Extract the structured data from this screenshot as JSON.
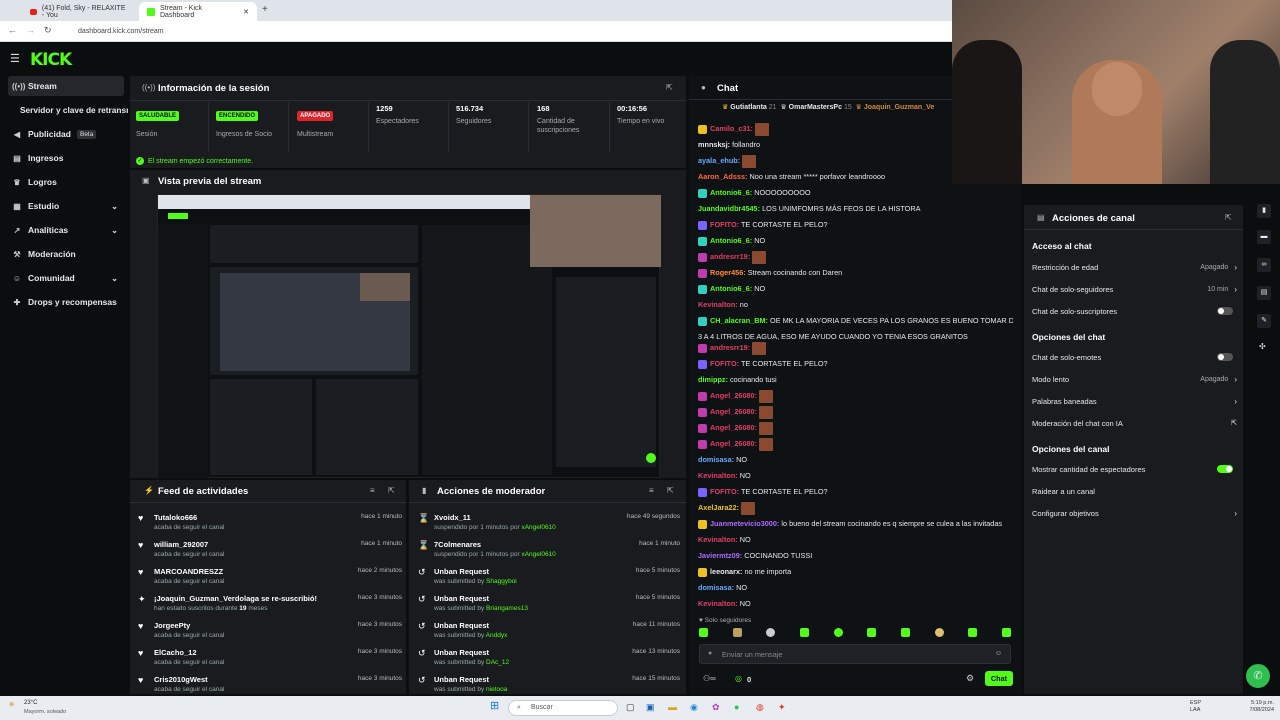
{
  "browser": {
    "tabs": [
      {
        "label": "(41) Fold, Sky - RELAXITE - You"
      },
      {
        "label": "Stream - Kick Dashboard"
      }
    ],
    "new_tab": "+",
    "url": "dashboard.kick.com/stream"
  },
  "app": {
    "logo": "KICK"
  },
  "sidebar": {
    "items": [
      {
        "label": "Stream",
        "icon": "broadcast-icon"
      },
      {
        "label": "Servidor y clave de retransm"
      },
      {
        "label": "Publicidad",
        "badge": "Beta"
      },
      {
        "label": "Ingresos"
      },
      {
        "label": "Logros"
      },
      {
        "label": "Estudio"
      },
      {
        "label": "Analíticas"
      },
      {
        "label": "Moderación"
      },
      {
        "label": "Comunidad"
      },
      {
        "label": "Drops y recompensas"
      }
    ]
  },
  "session": {
    "title": "Información de la sesión",
    "stats": [
      {
        "pill": "SALUDABLE",
        "label": "Sesión"
      },
      {
        "pill": "ENCENDIDO",
        "label": "Ingresos de Socio"
      },
      {
        "pill": "APAGADO",
        "label": "Multistream"
      },
      {
        "value": "1259",
        "label": "Espectadores"
      },
      {
        "value": "516.734",
        "label": "Seguidores"
      },
      {
        "value": "168",
        "label": "Cantidad de suscripciones"
      },
      {
        "value": "00:16:56",
        "label": "Tiempo en vivo"
      }
    ],
    "status": "El stream empezó correctamente."
  },
  "preview": {
    "title": "Vista previa del stream"
  },
  "feed": {
    "title": "Feed de actividades",
    "rows": [
      {
        "name": "Tutaloko666",
        "sub": "acaba de seguir el canal",
        "time": "hace 1 minuto"
      },
      {
        "name": "william_292007",
        "sub": "acaba de seguir el canal",
        "time": "hace 1 minuto"
      },
      {
        "name": "MARCOANDRESZZ",
        "sub": "acaba de seguir el canal",
        "time": "hace 2 minutos"
      },
      {
        "name": "¡Joaquin_Guzman_Verdolaga se re-suscribió!",
        "sub_pre": "han estado suscritos durante",
        "sub_num": "19",
        "sub_post": "meses",
        "time": "hace 3 minutos"
      },
      {
        "name": "JorgeePty",
        "sub": "acaba de seguir el canal",
        "time": "hace 3 minutos"
      },
      {
        "name": "ElCacho_12",
        "sub": "acaba de seguir el canal",
        "time": "hace 3 minutos"
      },
      {
        "name": "Cris2010gWest",
        "sub": "acaba de seguir el canal",
        "time": "hace 3 minutos"
      }
    ]
  },
  "mod": {
    "title": "Acciones de moderador",
    "rows": [
      {
        "name": "Xvoidx_11",
        "sub_pre": "suspendido por 1 minutos por",
        "by": "xAngel0610",
        "time": "hace 49 segundos"
      },
      {
        "name": "7Colmenares",
        "sub_pre": "suspendido por 1 minutos por",
        "by": "xAngel0610",
        "time": "hace 1 minuto"
      },
      {
        "name": "Unban Request",
        "sub_pre": "was submitted by",
        "by": "Shaggyboi",
        "time": "hace 5 minutos"
      },
      {
        "name": "Unban Request",
        "sub_pre": "was submitted by",
        "by": "Briangames13",
        "time": "hace 5 minutos"
      },
      {
        "name": "Unban Request",
        "sub_pre": "was submitted by",
        "by": "Anddyx",
        "time": "hace 11 minutos"
      },
      {
        "name": "Unban Request",
        "sub_pre": "was submitted by",
        "by": "DAc_12",
        "time": "hace 13 minutos"
      },
      {
        "name": "Unban Request",
        "sub_pre": "was submitted by",
        "by": "nietooa",
        "time": "hace 15 minutos"
      }
    ]
  },
  "chat": {
    "title": "Chat",
    "top_gifters": [
      {
        "name": "Gutiatlanta",
        "count": "21"
      },
      {
        "name": "OmarMastersPc",
        "count": "15"
      },
      {
        "name": "Joaquin_Guzman_Ve",
        "count": ""
      }
    ],
    "messages": [
      {
        "user": "Camilo_c31:",
        "text": "",
        "color": "#e23e66",
        "chip": "#f0c020",
        "emote": true
      },
      {
        "user": "mnnsksj:",
        "text": "follandro",
        "color": "#e6e8e9"
      },
      {
        "user": "ayala_ehub:",
        "text": "",
        "color": "#6aa8ff",
        "emote": true
      },
      {
        "user": "Aaron_Adsss:",
        "text": "Noo una stream ***** porfavor leandroooo",
        "color": "#ff6a3d"
      },
      {
        "user": "Antonio6_6:",
        "text": "NOOOOOOOOO",
        "color": "#53fc18",
        "chip": "#2fd0c0"
      },
      {
        "user": "Juandavidbr4545:",
        "text": "LOS UNIMFOMRS MÁS FEOS DE LA HISTORA",
        "color": "#53fc18"
      },
      {
        "user": "FOFITO:",
        "text": "TE CORTASTE EL PELO?",
        "color": "#e23e66",
        "chip": "#7b63ff"
      },
      {
        "user": "Antonio6_6:",
        "text": "NO",
        "color": "#53fc18",
        "chip": "#2fd0c0"
      },
      {
        "user": "andresrr19:",
        "text": "",
        "color": "#e23e66",
        "chip": "#c03ab0",
        "emote": true
      },
      {
        "user": "Roger456:",
        "text": "Stream cocinando con Daren",
        "color": "#ff8a3d",
        "chip": "#c03ab0"
      },
      {
        "user": "Antonio6_6:",
        "text": "NO",
        "color": "#53fc18",
        "chip": "#2fd0c0"
      },
      {
        "user": "Kevinalton:",
        "text": "no",
        "color": "#e23e66"
      },
      {
        "user": "CH_alacran_BM:",
        "text": "OE MK LA MAYORIA DE VECES PA LOS GRANOS ES BUENO TOMAR DE",
        "color": "#53fc18",
        "chip": "#2fd0c0"
      },
      {
        "user": "",
        "text": "3 A 4 LITROS DE AGUA, ESO ME AYUDO CUANDO YO TENIA ESOS GRANITOS",
        "color": "#e6e8e9"
      },
      {
        "user": "andresrr19:",
        "text": "",
        "color": "#e23e66",
        "chip": "#c03ab0",
        "emote": true
      },
      {
        "user": "FOFITO:",
        "text": "TE CORTASTE EL PELO?",
        "color": "#e23e66",
        "chip": "#7b63ff"
      },
      {
        "user": "dimippz:",
        "text": "cocinando tusi",
        "color": "#53fc18"
      },
      {
        "user": "Angel_26080:",
        "text": "",
        "color": "#e23e66",
        "chip": "#c03ab0",
        "emote": true
      },
      {
        "user": "Angel_26080:",
        "text": "",
        "color": "#e23e66",
        "chip": "#c03ab0",
        "emote": true
      },
      {
        "user": "Angel_26080:",
        "text": "",
        "color": "#e23e66",
        "chip": "#c03ab0",
        "emote": true
      },
      {
        "user": "Angel_26080:",
        "text": "",
        "color": "#e23e66",
        "chip": "#c03ab0",
        "emote": true
      },
      {
        "user": "domisasa:",
        "text": "NO",
        "color": "#6aa8ff"
      },
      {
        "user": "Kevinalton:",
        "text": "NO",
        "color": "#e23e66"
      },
      {
        "user": "FOFITO:",
        "text": "TE CORTASTE EL PELO?",
        "color": "#e23e66",
        "chip": "#7b63ff"
      },
      {
        "user": "AxelJara22:",
        "text": "",
        "color": "#f0c020",
        "emote": true
      },
      {
        "user": "Juanmetevicio3000:",
        "text": "lo bueno del stream cocinando es q siempre se culea a las invitadas",
        "color": "#b06aff",
        "chip": "#f0c020"
      },
      {
        "user": "Kevinalton:",
        "text": "NO",
        "color": "#e23e66"
      },
      {
        "user": "Javiermtz09:",
        "text": "COCINANDO TUSSI",
        "color": "#b06aff"
      },
      {
        "user": "leeonarx:",
        "text": "no me importa",
        "color": "#e6e8e9",
        "chip": "#f0c020"
      },
      {
        "user": "domisasa:",
        "text": "NO",
        "color": "#6aa8ff"
      },
      {
        "user": "Kevinalton:",
        "text": "NO",
        "color": "#e23e66"
      }
    ],
    "followers_only": "Solo seguidores",
    "input_placeholder": "Enviar un mensaje",
    "count": "0",
    "send_label": "Chat"
  },
  "channel_actions": {
    "title": "Acciones de canal",
    "sections": [
      {
        "heading": "Acceso al chat",
        "rows": [
          {
            "label": "Restricción de edad",
            "value": "Apagado",
            "kind": "arrow"
          },
          {
            "label": "Chat de solo-seguidores",
            "value": "10 min",
            "kind": "arrow",
            "green": true
          },
          {
            "label": "Chat de solo-suscriptores",
            "kind": "toggle",
            "on": false
          }
        ]
      },
      {
        "heading": "Opciones del chat",
        "rows": [
          {
            "label": "Chat de solo-emotes",
            "kind": "toggle",
            "on": false
          },
          {
            "label": "Modo lento",
            "value": "Apagado",
            "kind": "arrow"
          },
          {
            "label": "Palabras baneadas",
            "kind": "arrow"
          },
          {
            "label": "Moderación del chat con IA",
            "kind": "external"
          }
        ]
      },
      {
        "heading": "Opciones del canal",
        "rows": [
          {
            "label": "Mostrar cantidad de espectadores",
            "kind": "toggle",
            "on": true
          },
          {
            "label": "Raidear a un canal",
            "kind": "none"
          },
          {
            "label": "Configurar objetivos",
            "kind": "arrow"
          }
        ]
      }
    ]
  },
  "taskbar": {
    "weather_temp": "23°C",
    "weather_text": "Mayorm. soleado",
    "search": "Buscar",
    "lang": "ESP",
    "lang2": "LAA",
    "time": "5:19 p.m.",
    "date": "7/08/2024"
  },
  "colors": {
    "accent": "#53fc18",
    "panel": "#191b1f",
    "bg": "#0b0e0f"
  }
}
